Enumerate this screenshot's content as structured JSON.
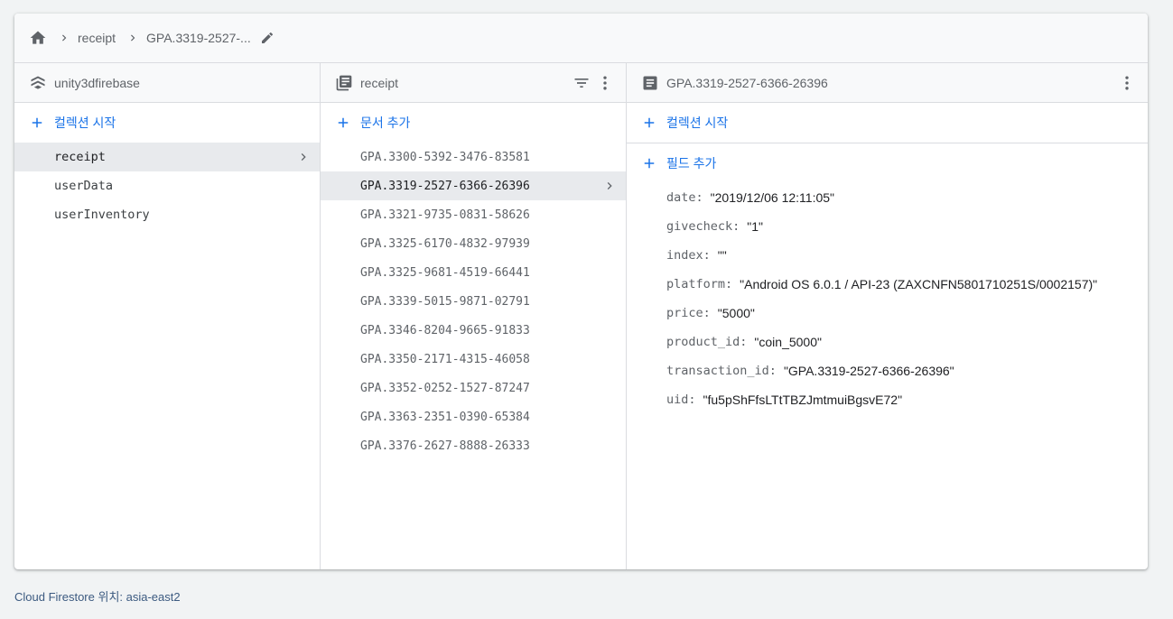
{
  "breadcrumb": {
    "home_icon": "home-icon",
    "items": [
      "receipt",
      "GPA.3319-2527-..."
    ],
    "edit_icon": "pencil-icon"
  },
  "column_project": {
    "title": "unity3dfirebase",
    "icon": "firestore-icon",
    "add_label": "컬렉션 시작",
    "items": [
      {
        "label": "receipt",
        "selected": true
      },
      {
        "label": "userData",
        "selected": false
      },
      {
        "label": "userInventory",
        "selected": false
      }
    ]
  },
  "column_collection": {
    "title": "receipt",
    "icon": "collection-icon",
    "add_label": "문서 추가",
    "items": [
      {
        "label": "GPA.3300-5392-3476-83581",
        "selected": false
      },
      {
        "label": "GPA.3319-2527-6366-26396",
        "selected": true
      },
      {
        "label": "GPA.3321-9735-0831-58626",
        "selected": false
      },
      {
        "label": "GPA.3325-6170-4832-97939",
        "selected": false
      },
      {
        "label": "GPA.3325-9681-4519-66441",
        "selected": false
      },
      {
        "label": "GPA.3339-5015-9871-02791",
        "selected": false
      },
      {
        "label": "GPA.3346-8204-9665-91833",
        "selected": false
      },
      {
        "label": "GPA.3350-2171-4315-46058",
        "selected": false
      },
      {
        "label": "GPA.3352-0252-1527-87247",
        "selected": false
      },
      {
        "label": "GPA.3363-2351-0390-65384",
        "selected": false
      },
      {
        "label": "GPA.3376-2627-8888-26333",
        "selected": false
      }
    ]
  },
  "column_document": {
    "title": "GPA.3319-2527-6366-26396",
    "icon": "document-icon",
    "add_collection_label": "컬렉션 시작",
    "add_field_label": "필드 추가",
    "fields": [
      {
        "key": "date",
        "value": "\"2019/12/06 12:11:05\""
      },
      {
        "key": "givecheck",
        "value": "\"1\""
      },
      {
        "key": "index",
        "value": "\"\""
      },
      {
        "key": "platform",
        "value": "\"Android OS 6.0.1 / API-23 (ZAXCNFN5801710251S/0002157)\""
      },
      {
        "key": "price",
        "value": "\"5000\""
      },
      {
        "key": "product_id",
        "value": "\"coin_5000\""
      },
      {
        "key": "transaction_id",
        "value": "\"GPA.3319-2527-6366-26396\""
      },
      {
        "key": "uid",
        "value": "\"fu5pShFfsLTtTBZJmtmuiBgsvE72\""
      }
    ]
  },
  "footer": {
    "text": "Cloud Firestore 위치: asia-east2"
  },
  "colors": {
    "accent": "#1a73e8",
    "selected_bg": "#e8eaed",
    "header_bg": "#f8f9fa",
    "page_bg": "#f1f3f4"
  }
}
